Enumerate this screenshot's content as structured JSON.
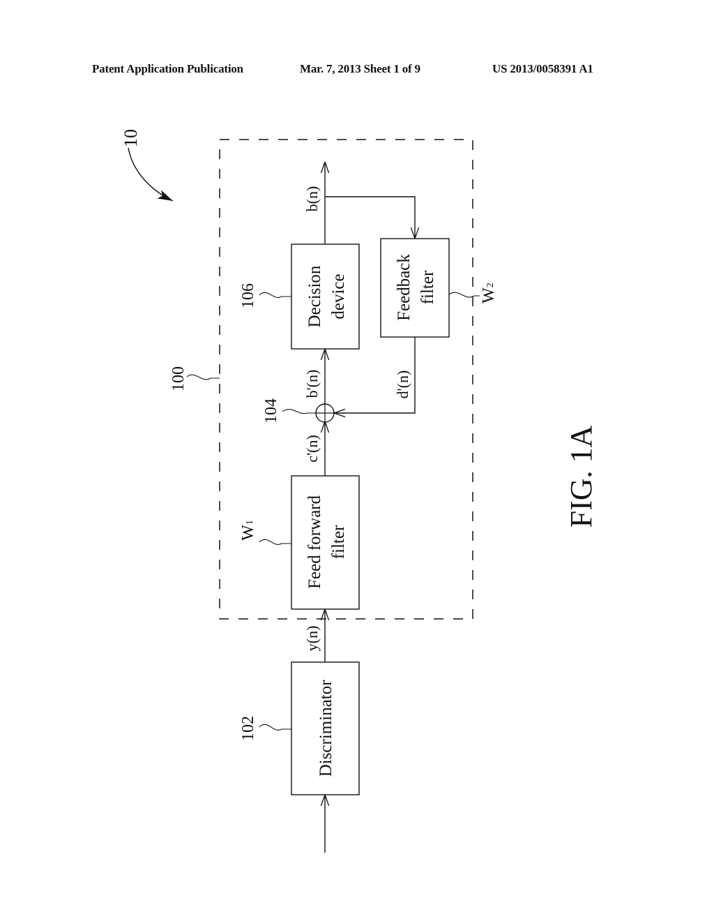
{
  "header": {
    "publication": "Patent Application Publication",
    "date_sheet": "Mar. 7, 2013   Sheet 1 of 9",
    "number": "US 2013/0058391 A1"
  },
  "figure": {
    "caption": "FIG. 1A",
    "system_ref": "10",
    "equalizer_ref": "100",
    "blocks": {
      "discriminator": {
        "ref": "102",
        "lines": [
          "Discriminator"
        ]
      },
      "feed_forward": {
        "ref": "W",
        "ref_sub": "1",
        "lines": [
          "Feed forward",
          "filter"
        ]
      },
      "adder": {
        "ref": "104"
      },
      "decision": {
        "ref": "106",
        "lines": [
          "Decision",
          "device"
        ]
      },
      "feedback": {
        "ref": "W",
        "ref_sub": "2",
        "lines": [
          "Feedback",
          "filter"
        ]
      }
    },
    "signals": {
      "y": "y(n)",
      "c": "c'(n)",
      "b_prime": "b'(n)",
      "b": "b(n)",
      "d": "d'(n)"
    }
  }
}
